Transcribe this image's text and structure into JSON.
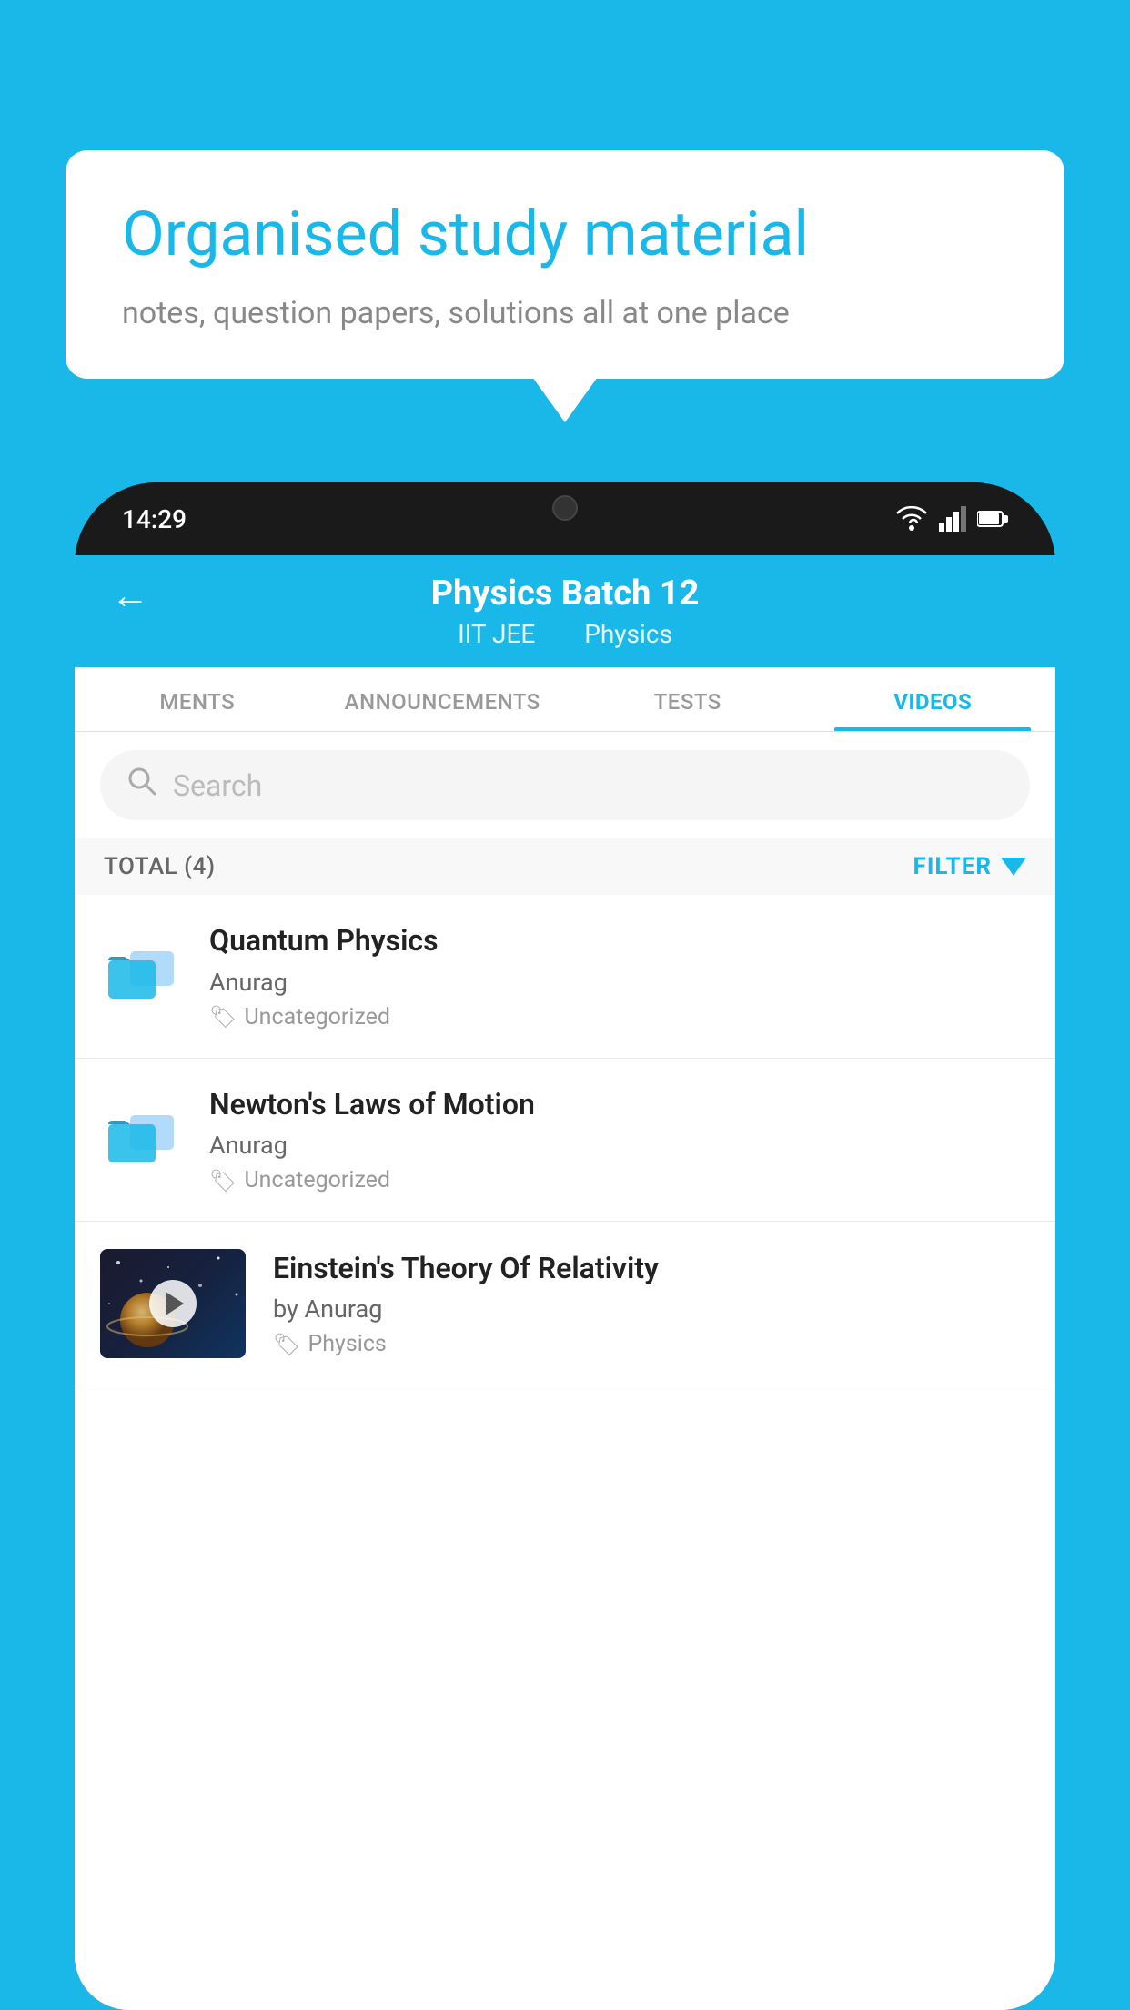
{
  "background_color": "#1ab8e8",
  "speech_bubble": {
    "title": "Organised study material",
    "subtitle": "notes, question papers, solutions all at one place"
  },
  "phone": {
    "status_time": "14:29",
    "header": {
      "title": "Physics Batch 12",
      "tag1": "IIT JEE",
      "tag2": "Physics",
      "back_label": "←"
    },
    "tabs": [
      {
        "label": "MENTS",
        "active": false
      },
      {
        "label": "ANNOUNCEMENTS",
        "active": false
      },
      {
        "label": "TESTS",
        "active": false
      },
      {
        "label": "VIDEOS",
        "active": true
      }
    ],
    "search": {
      "placeholder": "Search"
    },
    "filter_row": {
      "total_label": "TOTAL (4)",
      "filter_label": "FILTER"
    },
    "videos": [
      {
        "id": 1,
        "title": "Quantum Physics",
        "author": "Anurag",
        "tag": "Uncategorized",
        "has_thumbnail": false
      },
      {
        "id": 2,
        "title": "Newton's Laws of Motion",
        "author": "Anurag",
        "tag": "Uncategorized",
        "has_thumbnail": false
      },
      {
        "id": 3,
        "title": "Einstein's Theory Of Relativity",
        "author": "by Anurag",
        "tag": "Physics",
        "has_thumbnail": true
      }
    ]
  }
}
